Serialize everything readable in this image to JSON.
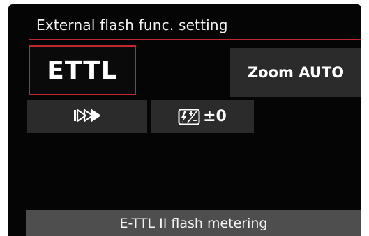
{
  "screen": {
    "title": "External flash func. setting"
  },
  "tiles": {
    "metering_mode": "ETTL",
    "zoom": "Zoom AUTO",
    "sync_icon": "high-speed-sync-icon",
    "comp_icon": "flash-exposure-comp-icon",
    "comp_value": "±0"
  },
  "status": {
    "description": "E-TTL II flash metering"
  },
  "colors": {
    "accent": "#c4262e",
    "tile": "#2b2b2b",
    "status_bar": "#4e4e4e",
    "background": "#050505"
  }
}
